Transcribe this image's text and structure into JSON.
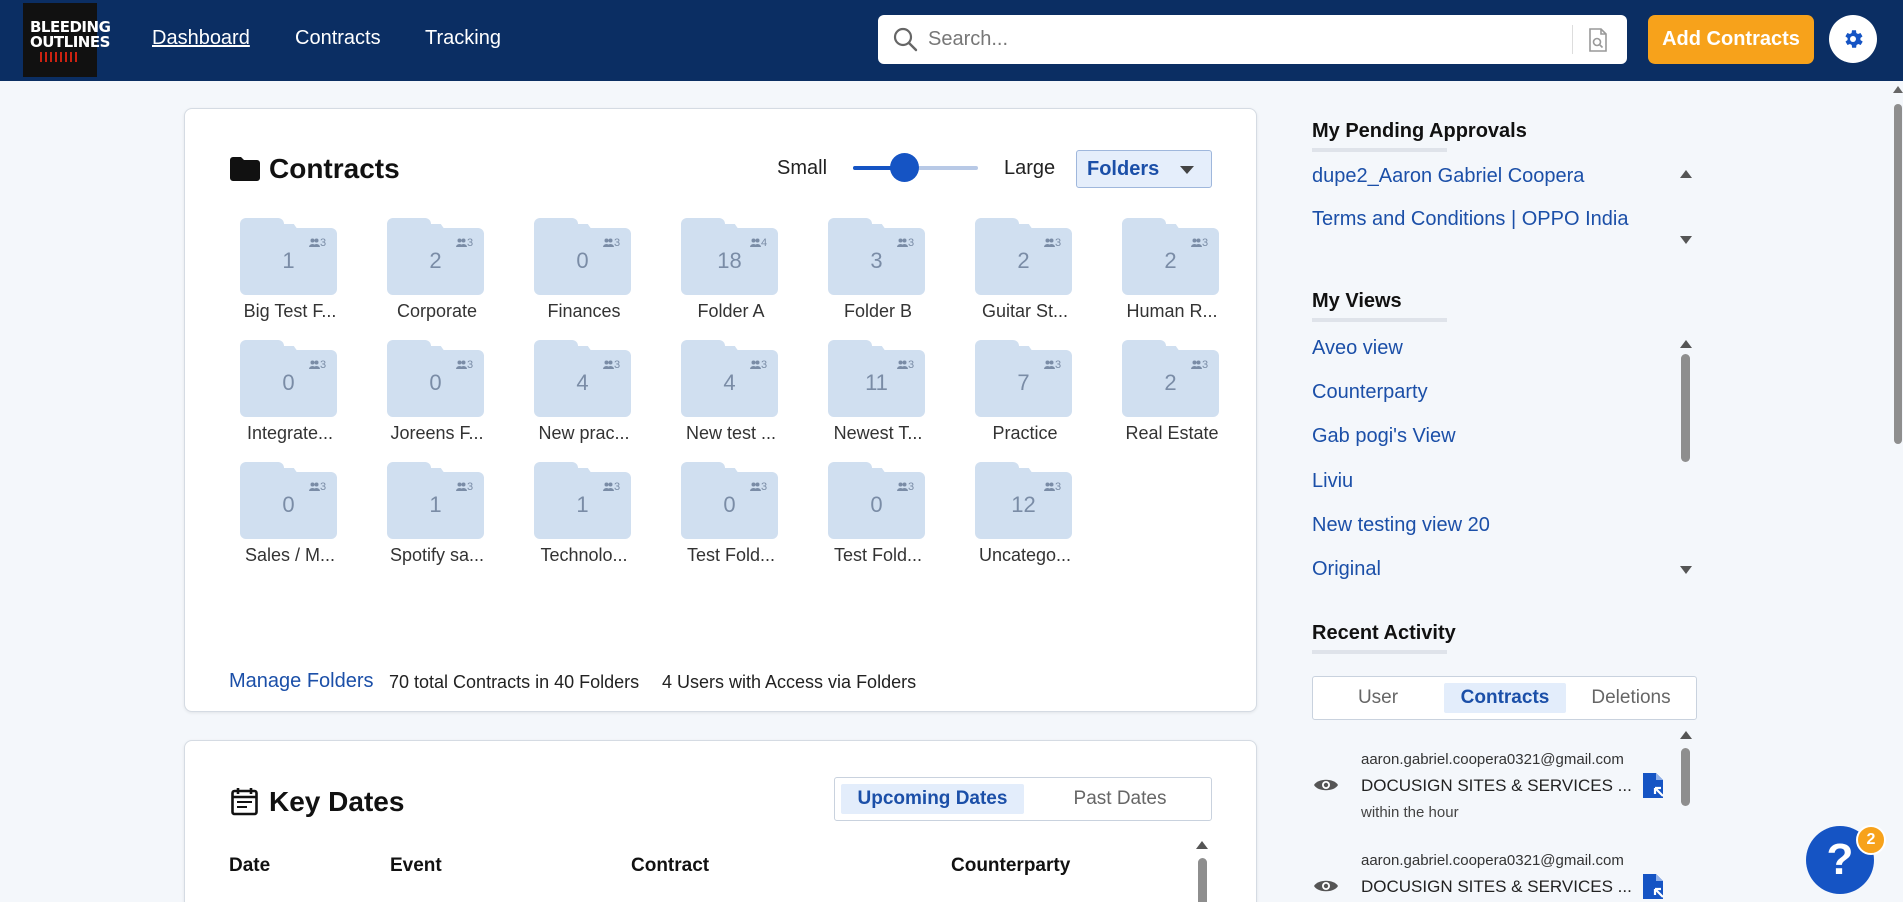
{
  "header": {
    "logo_text": "BLEEDING OUTLINES",
    "nav": [
      {
        "label": "Dashboard",
        "active": true
      },
      {
        "label": "Contracts",
        "active": false
      },
      {
        "label": "Tracking",
        "active": false
      }
    ],
    "search_placeholder": "Search...",
    "search_value": "",
    "add_button": "Add Contracts",
    "icons": {
      "search": "search-icon",
      "doc_search": "document-search-icon",
      "settings": "gear-icon"
    },
    "colors": {
      "bar": "#0b2e63",
      "accent": "#f7a21b",
      "link": "#1b4fa8"
    }
  },
  "contracts": {
    "title": "Contracts",
    "size_small": "Small",
    "size_large": "Large",
    "size_level": 0.33,
    "view_select": "Folders",
    "folders": [
      {
        "name": "Big Test F...",
        "count": "1",
        "users": "3"
      },
      {
        "name": "Corporate",
        "count": "2",
        "users": "3"
      },
      {
        "name": "Finances",
        "count": "0",
        "users": "3"
      },
      {
        "name": "Folder A",
        "count": "18",
        "users": "4"
      },
      {
        "name": "Folder B",
        "count": "3",
        "users": "3"
      },
      {
        "name": "Guitar St...",
        "count": "2",
        "users": "3"
      },
      {
        "name": "Human R...",
        "count": "2",
        "users": "3"
      },
      {
        "name": "Integrate...",
        "count": "0",
        "users": "3"
      },
      {
        "name": "Joreens F...",
        "count": "0",
        "users": "3"
      },
      {
        "name": "New prac...",
        "count": "4",
        "users": "3"
      },
      {
        "name": "New test ...",
        "count": "4",
        "users": "3"
      },
      {
        "name": "Newest T...",
        "count": "11",
        "users": "3"
      },
      {
        "name": "Practice",
        "count": "7",
        "users": "3"
      },
      {
        "name": "Real Estate",
        "count": "2",
        "users": "3"
      },
      {
        "name": "Sales / M...",
        "count": "0",
        "users": "3"
      },
      {
        "name": "Spotify sa...",
        "count": "1",
        "users": "3"
      },
      {
        "name": "Technolo...",
        "count": "1",
        "users": "3"
      },
      {
        "name": "Test Fold...",
        "count": "0",
        "users": "3"
      },
      {
        "name": "Test Fold...",
        "count": "0",
        "users": "3"
      },
      {
        "name": "Uncatego...",
        "count": "12",
        "users": "3"
      }
    ],
    "manage_link": "Manage Folders",
    "stats": [
      "70 total Contracts in 40 Folders",
      "4 Users with Access via Folders"
    ]
  },
  "key_dates": {
    "title": "Key Dates",
    "tabs": [
      {
        "label": "Upcoming Dates",
        "active": true
      },
      {
        "label": "Past Dates",
        "active": false
      }
    ],
    "columns": [
      "Date",
      "Event",
      "Contract",
      "Counterparty"
    ]
  },
  "pending": {
    "title": "My Pending Approvals",
    "items": [
      "dupe2_Aaron Gabriel Coopera",
      "Terms and Conditions | OPPO India"
    ]
  },
  "views": {
    "title": "My Views",
    "items": [
      "Aveo view",
      "Counterparty",
      "Gab pogi's View",
      "Liviu",
      "New testing view 20",
      "Original"
    ]
  },
  "activity": {
    "title": "Recent Activity",
    "tabs": [
      {
        "label": "User",
        "active": false
      },
      {
        "label": "Contracts",
        "active": true
      },
      {
        "label": "Deletions",
        "active": false
      }
    ],
    "items": [
      {
        "email": "aaron.gabriel.coopera0321@gmail.com",
        "title": "DOCUSIGN SITES & SERVICES ...",
        "time": "within the hour"
      },
      {
        "email": "aaron.gabriel.coopera0321@gmail.com",
        "title": "DOCUSIGN SITES & SERVICES ...",
        "time": ""
      }
    ]
  },
  "help": {
    "label": "?",
    "badge": "2"
  }
}
